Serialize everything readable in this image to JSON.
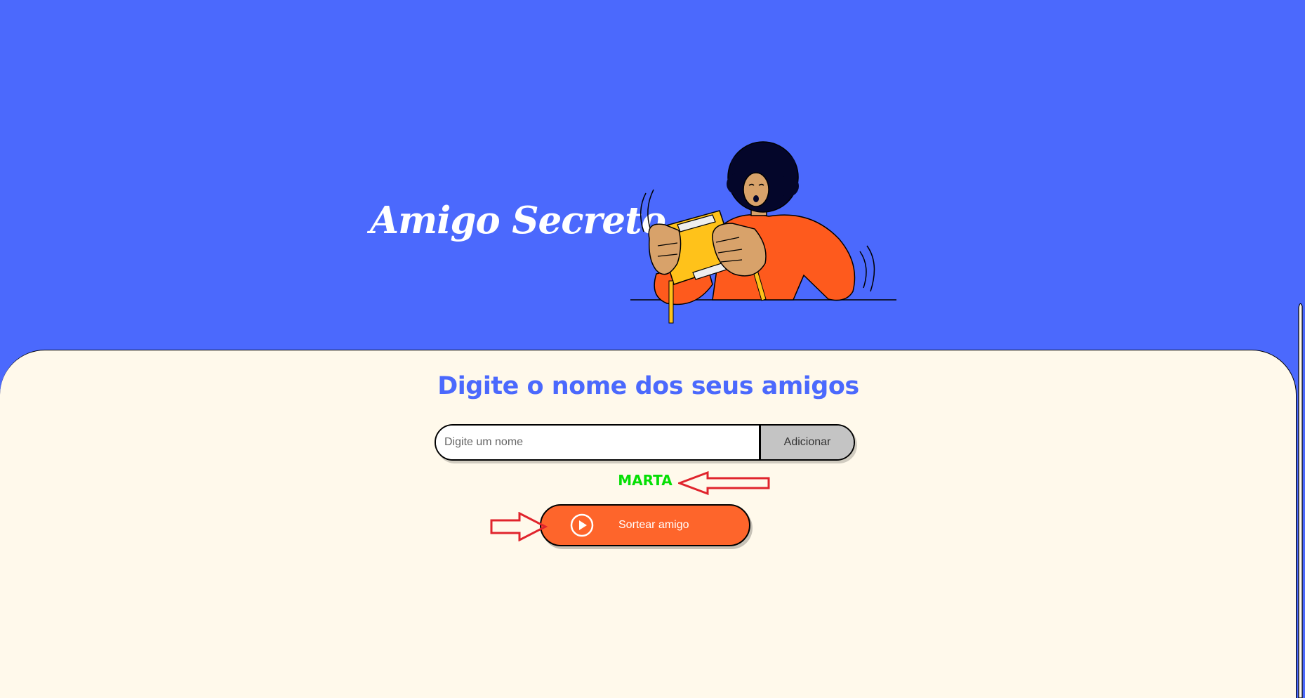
{
  "header": {
    "title": "Amigo Secreto"
  },
  "main": {
    "subtitle": "Digite o nome dos seus amigos",
    "input": {
      "placeholder": "Digite um nome",
      "value": ""
    },
    "add_button_label": "Adicionar",
    "result_name": "MARTA",
    "draw_button_label": "Sortear amigo"
  },
  "icons": {
    "draw_button_icon": "play-circle-icon"
  },
  "colors": {
    "header_background": "#4B69FD",
    "content_background": "#FFF9EB",
    "subtitle": "#4B69FD",
    "result_text": "#05DF05",
    "draw_button": "#FE652B",
    "add_button": "#C4C4C4",
    "annotation_arrow": "#E0242C"
  }
}
